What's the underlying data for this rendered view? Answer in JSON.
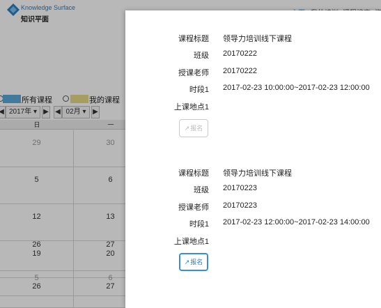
{
  "header": {
    "brand_en": "Knowledge Surface",
    "brand_cn": "知识平面",
    "nav": [
      "主页",
      "我的培训",
      "课程搜索",
      "资"
    ]
  },
  "legend": {
    "all_courses": "所有课程",
    "my_courses": "我的课程",
    "all_color": "#5aa9d6",
    "my_color": "#e5dc86"
  },
  "calendar": {
    "prev": "◀",
    "next": "▶",
    "year": "2017年",
    "month": "02月",
    "caret": "▾",
    "weekdays": [
      "日",
      "一"
    ],
    "weeks": [
      [
        "29",
        "30"
      ],
      [
        "5",
        "6"
      ],
      [
        "12",
        "13"
      ],
      [
        "19",
        "20"
      ],
      [
        "26",
        "27"
      ],
      [
        "5",
        "6"
      ]
    ]
  },
  "modal": {
    "courses": [
      {
        "title_label": "课程标题",
        "title": "领导力培训线下课程",
        "class_label": "班级",
        "class": "20170222",
        "teacher_label": "授课老师",
        "teacher": "20170222",
        "period_label": "时段1",
        "period": "2017-02-23 10:00:00~2017-02-23 12:00:00",
        "location_label": "上课地点1",
        "location": "",
        "signup_label": "报名",
        "signup_enabled": false
      },
      {
        "title_label": "课程标题",
        "title": "领导力培训线下课程",
        "class_label": "班级",
        "class": "20170223",
        "teacher_label": "授课老师",
        "teacher": "20170223",
        "period_label": "时段1",
        "period": "2017-02-23 12:00:00~2017-02-23 14:00:00",
        "location_label": "上课地点1",
        "location": "",
        "signup_label": "报名",
        "signup_enabled": true
      }
    ],
    "signup_icon": "↗"
  }
}
